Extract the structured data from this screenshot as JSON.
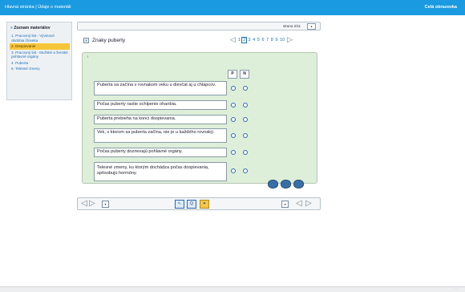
{
  "topbar": {
    "nav_home": "Hlavná stránka",
    "nav_sep": " | ",
    "nav_info": "Údaje o materiáli",
    "full_screen": "Celá obrazovka"
  },
  "sidebar": {
    "heading": "Zoznam materiálov",
    "items": [
      {
        "label": "1. Pracovný list - Vývinové obdobia človeka"
      },
      {
        "label": "2. Dospievanie"
      },
      {
        "label": "3. Pracovný list - Mužské a ženské pohlavné orgány"
      },
      {
        "label": "4. Puberta"
      },
      {
        "label": "5. Telesné zmeny"
      }
    ]
  },
  "pager": {
    "page_label": "strana 2/11",
    "pages": [
      "1",
      "2",
      "3",
      "4",
      "5",
      "6",
      "7",
      "8",
      "9",
      "10"
    ]
  },
  "exercise": {
    "title": "Znaky puberty",
    "col_p": "P",
    "col_n": "N",
    "questions": [
      "Puberta sa začína v rovnakom veku u dievčat aj u chlapcov.",
      "Počas puberty rastie ochlpenie ohanbia.",
      "Puberta prebieha na konci dospievania.",
      "Vek, v ktorom sa puberta začína, nie je u každého rovnaký.",
      "Počas puberty dozrievajú pohlavné orgány.",
      "Telesné zmeny, ku ktorým dochádza počas dospievania, spôsobujú hormóny."
    ]
  },
  "colors": {
    "topbar": "#1a9ae0",
    "panel": "#ddefd9",
    "radio": "#2a68b8",
    "active_item": "#f6c63a"
  }
}
